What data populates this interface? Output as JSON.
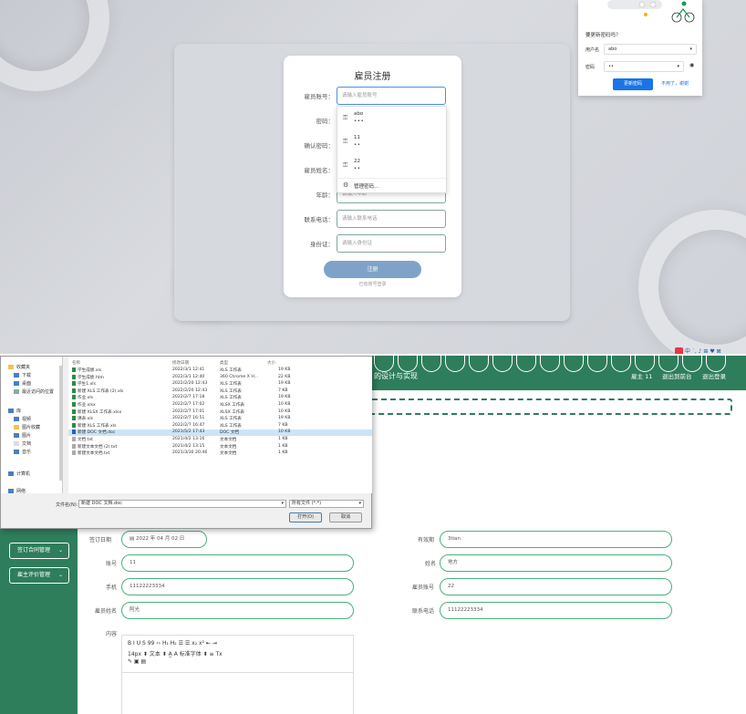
{
  "registration": {
    "title": "雇员注册",
    "fields": [
      {
        "label": "雇员账号：",
        "placeholder": "请输入雇员账号"
      },
      {
        "label": "密码：",
        "placeholder": ""
      },
      {
        "label": "确认密码：",
        "placeholder": ""
      },
      {
        "label": "雇员姓名：",
        "placeholder": ""
      },
      {
        "label": "年龄：",
        "placeholder": "请输入年龄"
      },
      {
        "label": "联系电话：",
        "placeholder": "请输入联系电话"
      },
      {
        "label": "身份证：",
        "placeholder": "请输入身份证"
      }
    ],
    "register_button": "注册",
    "login_link": "已有账号登录"
  },
  "autocomplete": {
    "items": [
      {
        "user": "abo",
        "dots": "•••"
      },
      {
        "user": "11",
        "dots": "••"
      },
      {
        "user": "22",
        "dots": "••"
      }
    ],
    "manage": "管理密码..."
  },
  "password_popup": {
    "question": "要更新密码吗？",
    "username_label": "用户名",
    "username_value": "abo",
    "password_label": "密码",
    "password_value": "••",
    "update_button": "更新密码",
    "decline": "不用了，谢谢"
  },
  "app": {
    "title": "的设计与实现",
    "user_label": "雇主 11",
    "exit_platform": "退出到前台",
    "logout": "退出登录",
    "sidebar": [
      "签订合同管理",
      "雇主评价管理"
    ]
  },
  "form": {
    "sign_date_label": "签订日期",
    "sign_date_value": "2022 年 04 月 02 日",
    "validity_label": "有效期",
    "validity_value": "3tian",
    "account_label": "账号",
    "account_value": "11",
    "name_label": "姓名",
    "name_value": "地方",
    "phone_label": "手机",
    "phone_value": "11122223334",
    "emp_account_label": "雇员账号",
    "emp_account_value": "22",
    "emp_name_label": "雇员姓名",
    "emp_name_value": "阿光",
    "contact_label": "联系电话",
    "contact_value": "11122223334",
    "content_label": "内容",
    "toolbar_row1": "B  I  U  S    99  ‹›    H₁  H₂    ☰  ☰    x₂  x²    ⇤  ⇥",
    "toolbar_row2": "14px      ⬍      文本      ⬍      A̲  A      标准字体      ⬍      ≡      Tx",
    "toolbar_row3": "✎  ▣  ▤"
  },
  "file_dialog": {
    "tree": [
      "收藏夹",
      "下载",
      "桌面",
      "最近访问的位置",
      "库",
      "视频",
      "图片收藏",
      "图片",
      "文档",
      "音乐",
      "计算机",
      "网络"
    ],
    "headers": [
      "名称",
      "修改日期",
      "类型",
      "大小"
    ],
    "files": [
      {
        "name": "学生成绩.xls",
        "date": "2022/3/1 12:41",
        "type": "XLS 工作表",
        "size": "19 KB",
        "kind": "xls"
      },
      {
        "name": "学生成绩.htm",
        "date": "2022/3/1 12:40",
        "type": "360 Chrome X H...",
        "size": "22 KB",
        "kind": "xls"
      },
      {
        "name": "学生1.xls",
        "date": "2022/2/20 12:43",
        "type": "XLS 工作表",
        "size": "19 KB",
        "kind": "xls"
      },
      {
        "name": "新建 XLS 工作表 (2).xls",
        "date": "2022/2/20 12:43",
        "type": "XLS 工作表",
        "size": "7 KB",
        "kind": "xls"
      },
      {
        "name": "作业.xls",
        "date": "2022/2/7 17:18",
        "type": "XLS 工作表",
        "size": "19 KB",
        "kind": "xls"
      },
      {
        "name": "作业.xlsx",
        "date": "2022/2/7 17:02",
        "type": "XLSX 工作表",
        "size": "10 KB",
        "kind": "xls"
      },
      {
        "name": "新建 XLSX 工作表.xlsx",
        "date": "2022/2/7 17:01",
        "type": "XLSX 工作表",
        "size": "10 KB",
        "kind": "xls"
      },
      {
        "name": "课表.xls",
        "date": "2022/2/7 16:51",
        "type": "XLS 工作表",
        "size": "19 KB",
        "kind": "xls"
      },
      {
        "name": "新建 XLS 工作表.xls",
        "date": "2022/2/7 16:47",
        "type": "XLS 工作表",
        "size": "7 KB",
        "kind": "xls"
      },
      {
        "name": "新建 DOC 文档.doc",
        "date": "2021/5/2 17:43",
        "type": "DOC 文档",
        "size": "10 KB",
        "kind": "doc",
        "selected": true
      },
      {
        "name": "文档.txt",
        "date": "2021/4/2 13:16",
        "type": "文本文档",
        "size": "1 KB",
        "kind": "txt"
      },
      {
        "name": "新建文本文档 (2).txt",
        "date": "2021/4/2 13:15",
        "type": "文本文档",
        "size": "1 KB",
        "kind": "txt"
      },
      {
        "name": "新建文本文档.txt",
        "date": "2021/3/30 20:46",
        "type": "文本文档",
        "size": "1 KB",
        "kind": "txt"
      }
    ],
    "filename_label": "文件名(N):",
    "filename_value": "新建 DOC 文档.doc",
    "filetype_value": "所有文件 (*.*)",
    "open_button": "打开(O)",
    "cancel_button": "取消"
  },
  "colors": {
    "theme_green": "#2e7d5b",
    "accent_blue": "#1a73e8",
    "register_btn": "#7fa3c8"
  }
}
